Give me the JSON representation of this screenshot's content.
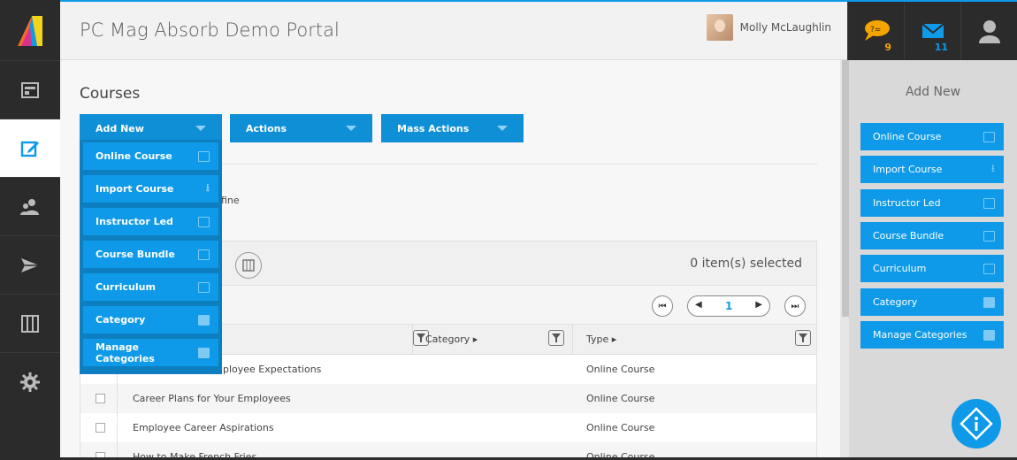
{
  "header": {
    "portal_title": "PC Mag Absorb Demo Portal",
    "user_name": "Molly McLaughlin"
  },
  "top_icons": {
    "chat_count": "9",
    "mail_count": "11"
  },
  "sidebar": {
    "items": [
      {
        "icon": "dashboard-icon"
      },
      {
        "icon": "courses-edit-icon",
        "active": true
      },
      {
        "icon": "users-icon"
      },
      {
        "icon": "paper-plane-icon"
      },
      {
        "icon": "columns-icon"
      },
      {
        "icon": "gear-icon"
      }
    ]
  },
  "main": {
    "page_title": "Courses",
    "buttons": {
      "add_new": "Add New",
      "actions": "Actions",
      "mass_actions": "Mass Actions"
    },
    "fine_text": "fine",
    "dropdown": [
      "Online Course",
      "Import Course",
      "Instructor Led",
      "Course Bundle",
      "Curriculum",
      "Category",
      "Manage Categories"
    ]
  },
  "grid": {
    "selected_text": "0 item(s) selected",
    "page_number": "1",
    "columns": {
      "category": "Category ▸",
      "type": "Type ▸"
    },
    "rows": [
      {
        "name": "nployee Expectations",
        "type": "Online Course"
      },
      {
        "name": "Career Plans for Your Employees",
        "type": "Online Course"
      },
      {
        "name": "Employee Career Aspirations",
        "type": "Online Course"
      },
      {
        "name": "How to Make French Fries",
        "type": "Online Course"
      }
    ]
  },
  "right_panel": {
    "title": "Add New",
    "items": [
      "Online Course",
      "Import Course",
      "Instructor Led",
      "Course Bundle",
      "Curriculum",
      "Category",
      "Manage Categories"
    ]
  },
  "colors": {
    "accent": "#0e9ae8",
    "sidebar": "#2b2b2b",
    "badge": "#f5a400"
  }
}
